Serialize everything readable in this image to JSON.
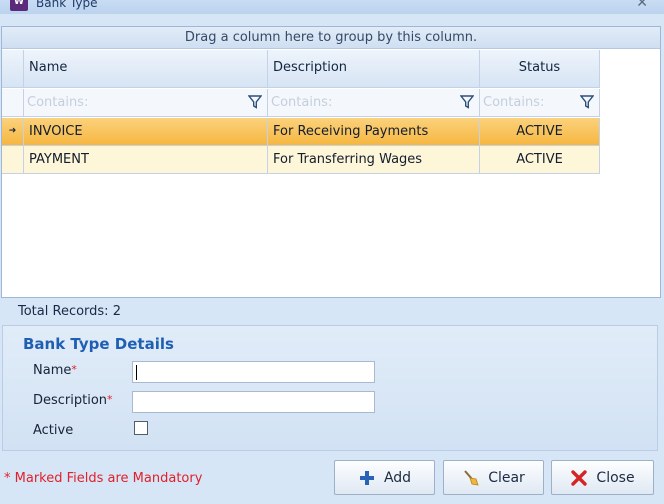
{
  "window": {
    "title": "Bank Type",
    "app_icon_text": "W",
    "close_glyph": "✕"
  },
  "grid": {
    "group_hint": "Drag a column here to group by this column.",
    "columns": [
      "Name",
      "Description",
      "Status"
    ],
    "filter_placeholder": "Contains:",
    "rows": [
      {
        "name": "INVOICE",
        "description": "For Receiving Payments",
        "status": "ACTIVE",
        "selected": true
      },
      {
        "name": "PAYMENT",
        "description": "For Transferring Wages",
        "status": "ACTIVE",
        "selected": false
      }
    ],
    "row_indicator": "➜",
    "total_records": "Total Records: 2"
  },
  "details": {
    "title": "Bank Type Details",
    "name_label": "Name",
    "description_label": "Description",
    "active_label": "Active",
    "required_marker": "*",
    "name_value": "",
    "description_value": "",
    "active_checked": false
  },
  "footer": {
    "mandatory_note": "* Marked Fields are Mandatory",
    "add_label": "Add",
    "clear_label": "Clear",
    "close_label": "Close"
  },
  "colors": {
    "selected_row": "#f6b640",
    "alt_row": "#fdf6d9",
    "required": "#e0202a",
    "accent": "#1f5fb3"
  },
  "icons": {
    "add": "plus-icon",
    "clear": "broom-icon",
    "close": "x-icon",
    "filter": "funnel-icon"
  }
}
